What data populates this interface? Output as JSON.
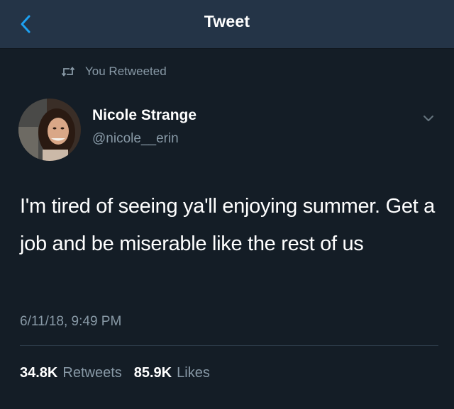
{
  "header": {
    "title": "Tweet",
    "back_icon": "chevron-left-icon",
    "accent_color": "#1da1f2"
  },
  "retweet_context": {
    "icon": "retweet-icon",
    "text": "You Retweeted"
  },
  "tweet": {
    "author_name": "Nicole Strange",
    "author_handle": "@nicole__erin",
    "text": "I'm tired of seeing ya'll enjoying summer. Get a job and be miserable like the rest of us",
    "timestamp": "6/11/18, 9:49 PM",
    "menu_icon": "chevron-down-icon",
    "stats": {
      "retweets_count": "34.8K",
      "retweets_label": "Retweets",
      "likes_count": "85.9K",
      "likes_label": "Likes"
    }
  }
}
